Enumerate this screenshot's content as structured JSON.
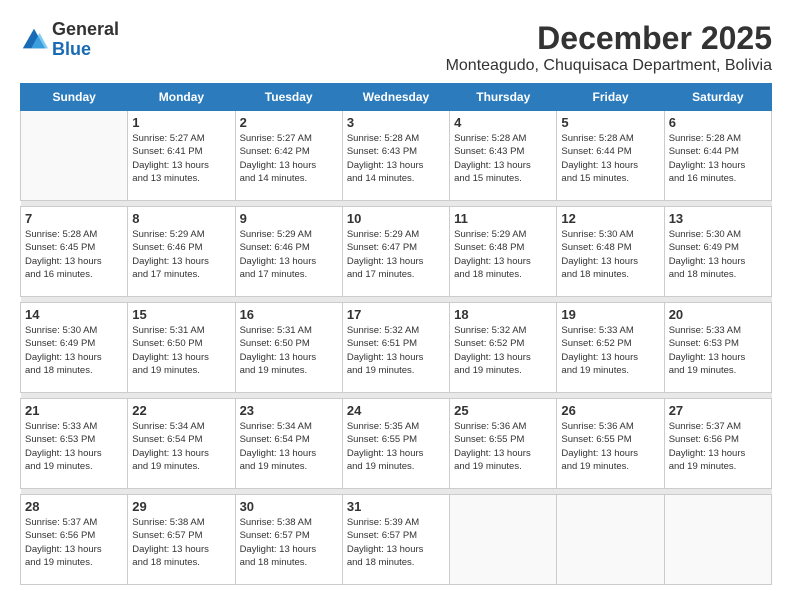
{
  "header": {
    "logo_general": "General",
    "logo_blue": "Blue",
    "month_title": "December 2025",
    "location": "Monteagudo, Chuquisaca Department, Bolivia"
  },
  "days_of_week": [
    "Sunday",
    "Monday",
    "Tuesday",
    "Wednesday",
    "Thursday",
    "Friday",
    "Saturday"
  ],
  "weeks": [
    [
      {
        "day": "",
        "info": ""
      },
      {
        "day": "1",
        "info": "Sunrise: 5:27 AM\nSunset: 6:41 PM\nDaylight: 13 hours\nand 13 minutes."
      },
      {
        "day": "2",
        "info": "Sunrise: 5:27 AM\nSunset: 6:42 PM\nDaylight: 13 hours\nand 14 minutes."
      },
      {
        "day": "3",
        "info": "Sunrise: 5:28 AM\nSunset: 6:43 PM\nDaylight: 13 hours\nand 14 minutes."
      },
      {
        "day": "4",
        "info": "Sunrise: 5:28 AM\nSunset: 6:43 PM\nDaylight: 13 hours\nand 15 minutes."
      },
      {
        "day": "5",
        "info": "Sunrise: 5:28 AM\nSunset: 6:44 PM\nDaylight: 13 hours\nand 15 minutes."
      },
      {
        "day": "6",
        "info": "Sunrise: 5:28 AM\nSunset: 6:44 PM\nDaylight: 13 hours\nand 16 minutes."
      }
    ],
    [
      {
        "day": "7",
        "info": "Sunrise: 5:28 AM\nSunset: 6:45 PM\nDaylight: 13 hours\nand 16 minutes."
      },
      {
        "day": "8",
        "info": "Sunrise: 5:29 AM\nSunset: 6:46 PM\nDaylight: 13 hours\nand 17 minutes."
      },
      {
        "day": "9",
        "info": "Sunrise: 5:29 AM\nSunset: 6:46 PM\nDaylight: 13 hours\nand 17 minutes."
      },
      {
        "day": "10",
        "info": "Sunrise: 5:29 AM\nSunset: 6:47 PM\nDaylight: 13 hours\nand 17 minutes."
      },
      {
        "day": "11",
        "info": "Sunrise: 5:29 AM\nSunset: 6:48 PM\nDaylight: 13 hours\nand 18 minutes."
      },
      {
        "day": "12",
        "info": "Sunrise: 5:30 AM\nSunset: 6:48 PM\nDaylight: 13 hours\nand 18 minutes."
      },
      {
        "day": "13",
        "info": "Sunrise: 5:30 AM\nSunset: 6:49 PM\nDaylight: 13 hours\nand 18 minutes."
      }
    ],
    [
      {
        "day": "14",
        "info": "Sunrise: 5:30 AM\nSunset: 6:49 PM\nDaylight: 13 hours\nand 18 minutes."
      },
      {
        "day": "15",
        "info": "Sunrise: 5:31 AM\nSunset: 6:50 PM\nDaylight: 13 hours\nand 19 minutes."
      },
      {
        "day": "16",
        "info": "Sunrise: 5:31 AM\nSunset: 6:50 PM\nDaylight: 13 hours\nand 19 minutes."
      },
      {
        "day": "17",
        "info": "Sunrise: 5:32 AM\nSunset: 6:51 PM\nDaylight: 13 hours\nand 19 minutes."
      },
      {
        "day": "18",
        "info": "Sunrise: 5:32 AM\nSunset: 6:52 PM\nDaylight: 13 hours\nand 19 minutes."
      },
      {
        "day": "19",
        "info": "Sunrise: 5:33 AM\nSunset: 6:52 PM\nDaylight: 13 hours\nand 19 minutes."
      },
      {
        "day": "20",
        "info": "Sunrise: 5:33 AM\nSunset: 6:53 PM\nDaylight: 13 hours\nand 19 minutes."
      }
    ],
    [
      {
        "day": "21",
        "info": "Sunrise: 5:33 AM\nSunset: 6:53 PM\nDaylight: 13 hours\nand 19 minutes."
      },
      {
        "day": "22",
        "info": "Sunrise: 5:34 AM\nSunset: 6:54 PM\nDaylight: 13 hours\nand 19 minutes."
      },
      {
        "day": "23",
        "info": "Sunrise: 5:34 AM\nSunset: 6:54 PM\nDaylight: 13 hours\nand 19 minutes."
      },
      {
        "day": "24",
        "info": "Sunrise: 5:35 AM\nSunset: 6:55 PM\nDaylight: 13 hours\nand 19 minutes."
      },
      {
        "day": "25",
        "info": "Sunrise: 5:36 AM\nSunset: 6:55 PM\nDaylight: 13 hours\nand 19 minutes."
      },
      {
        "day": "26",
        "info": "Sunrise: 5:36 AM\nSunset: 6:55 PM\nDaylight: 13 hours\nand 19 minutes."
      },
      {
        "day": "27",
        "info": "Sunrise: 5:37 AM\nSunset: 6:56 PM\nDaylight: 13 hours\nand 19 minutes."
      }
    ],
    [
      {
        "day": "28",
        "info": "Sunrise: 5:37 AM\nSunset: 6:56 PM\nDaylight: 13 hours\nand 19 minutes."
      },
      {
        "day": "29",
        "info": "Sunrise: 5:38 AM\nSunset: 6:57 PM\nDaylight: 13 hours\nand 18 minutes."
      },
      {
        "day": "30",
        "info": "Sunrise: 5:38 AM\nSunset: 6:57 PM\nDaylight: 13 hours\nand 18 minutes."
      },
      {
        "day": "31",
        "info": "Sunrise: 5:39 AM\nSunset: 6:57 PM\nDaylight: 13 hours\nand 18 minutes."
      },
      {
        "day": "",
        "info": ""
      },
      {
        "day": "",
        "info": ""
      },
      {
        "day": "",
        "info": ""
      }
    ]
  ]
}
